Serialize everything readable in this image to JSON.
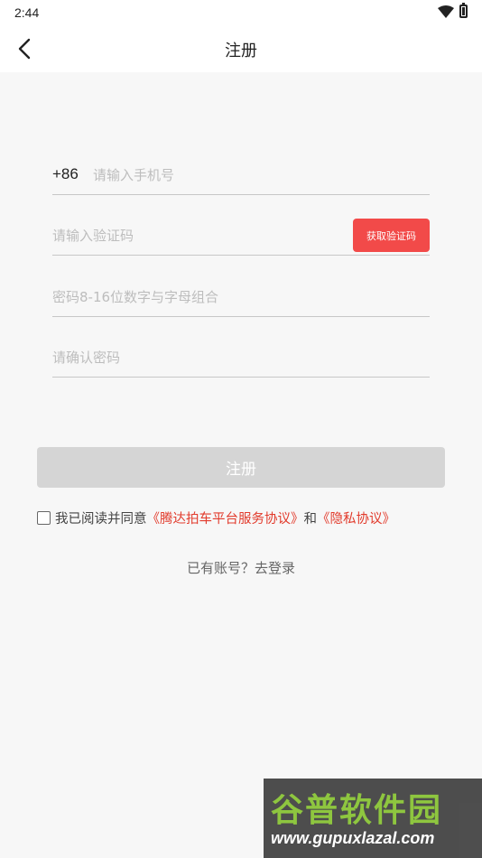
{
  "status_bar": {
    "time": "2:44",
    "icons": [
      "wifi-icon",
      "battery-icon"
    ]
  },
  "header": {
    "title": "注册",
    "back_icon": "chevron-left-icon"
  },
  "form": {
    "phone_prefix": "+86",
    "phone_placeholder": "请输入手机号",
    "code_placeholder": "请输入验证码",
    "get_code_label": "获取验证码",
    "password_placeholder": "密码8-16位数字与字母组合",
    "confirm_placeholder": "请确认密码"
  },
  "submit_label": "注册",
  "agreement": {
    "prefix": "我已阅读并同意",
    "service_link": "《腾达拍车平台服务协议》",
    "and": "和",
    "privacy_link": "《隐私协议》"
  },
  "login_link": "已有账号？去登录",
  "watermark": {
    "top": "谷普软件园",
    "bottom": "www.gupuxlazal.com"
  },
  "colors": {
    "accent": "#f24a49",
    "link": "#e23b2c",
    "disabled": "#d5d5d5"
  }
}
